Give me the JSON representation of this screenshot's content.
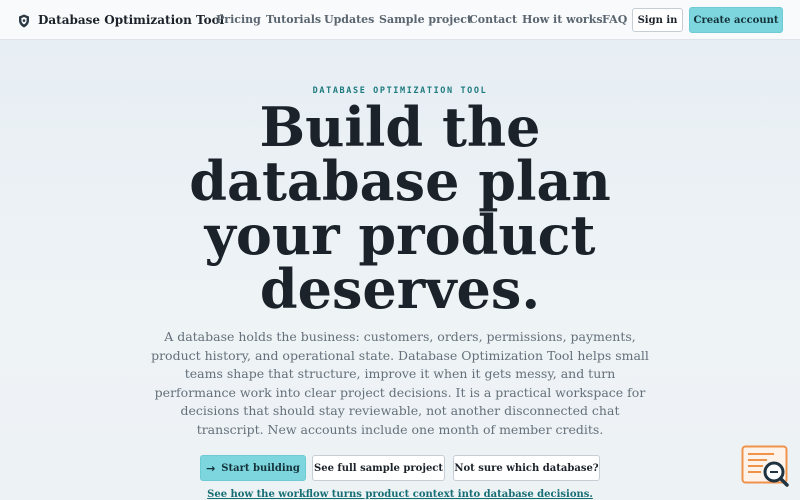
{
  "header": {
    "brand": "Database Optimization Tool",
    "brand_icon": "shield-icon",
    "nav": [
      {
        "label": "Pricing"
      },
      {
        "label": "Tutorials"
      },
      {
        "label": "Updates"
      },
      {
        "label": "Sample project"
      },
      {
        "label": "Contact"
      },
      {
        "label": "How it works"
      },
      {
        "label": "FAQ"
      }
    ],
    "signin_label": "Sign in",
    "create_label": "Create account"
  },
  "hero": {
    "eyebrow": "DATABASE OPTIMIZATION TOOL",
    "headline_lines": [
      "Build the",
      "database plan",
      "your product",
      "deserves."
    ],
    "lede": "A database holds the business: customers, orders, permissions, payments, product history, and operational state. Database Optimization Tool helps small teams shape that structure, improve it when it gets messy, and turn performance work into clear project decisions. It is a practical workspace for decisions that should stay reviewable, not another disconnected chat transcript. New accounts include one month of member credits.",
    "cta_primary": "Start building",
    "cta_primary_icon": "arrow-right-icon",
    "cta_sample": "See full sample project",
    "cta_which": "Not sure which database?",
    "workflow_link": "See how the workflow turns product context into database decisions."
  },
  "assistant_widget": {
    "icon": "search-document-icon"
  },
  "colors": {
    "accent": "#7dd6de",
    "eyebrow": "#1d7a7f",
    "text": "#1b2229",
    "muted": "#65707a",
    "widget": "#f0934a"
  }
}
